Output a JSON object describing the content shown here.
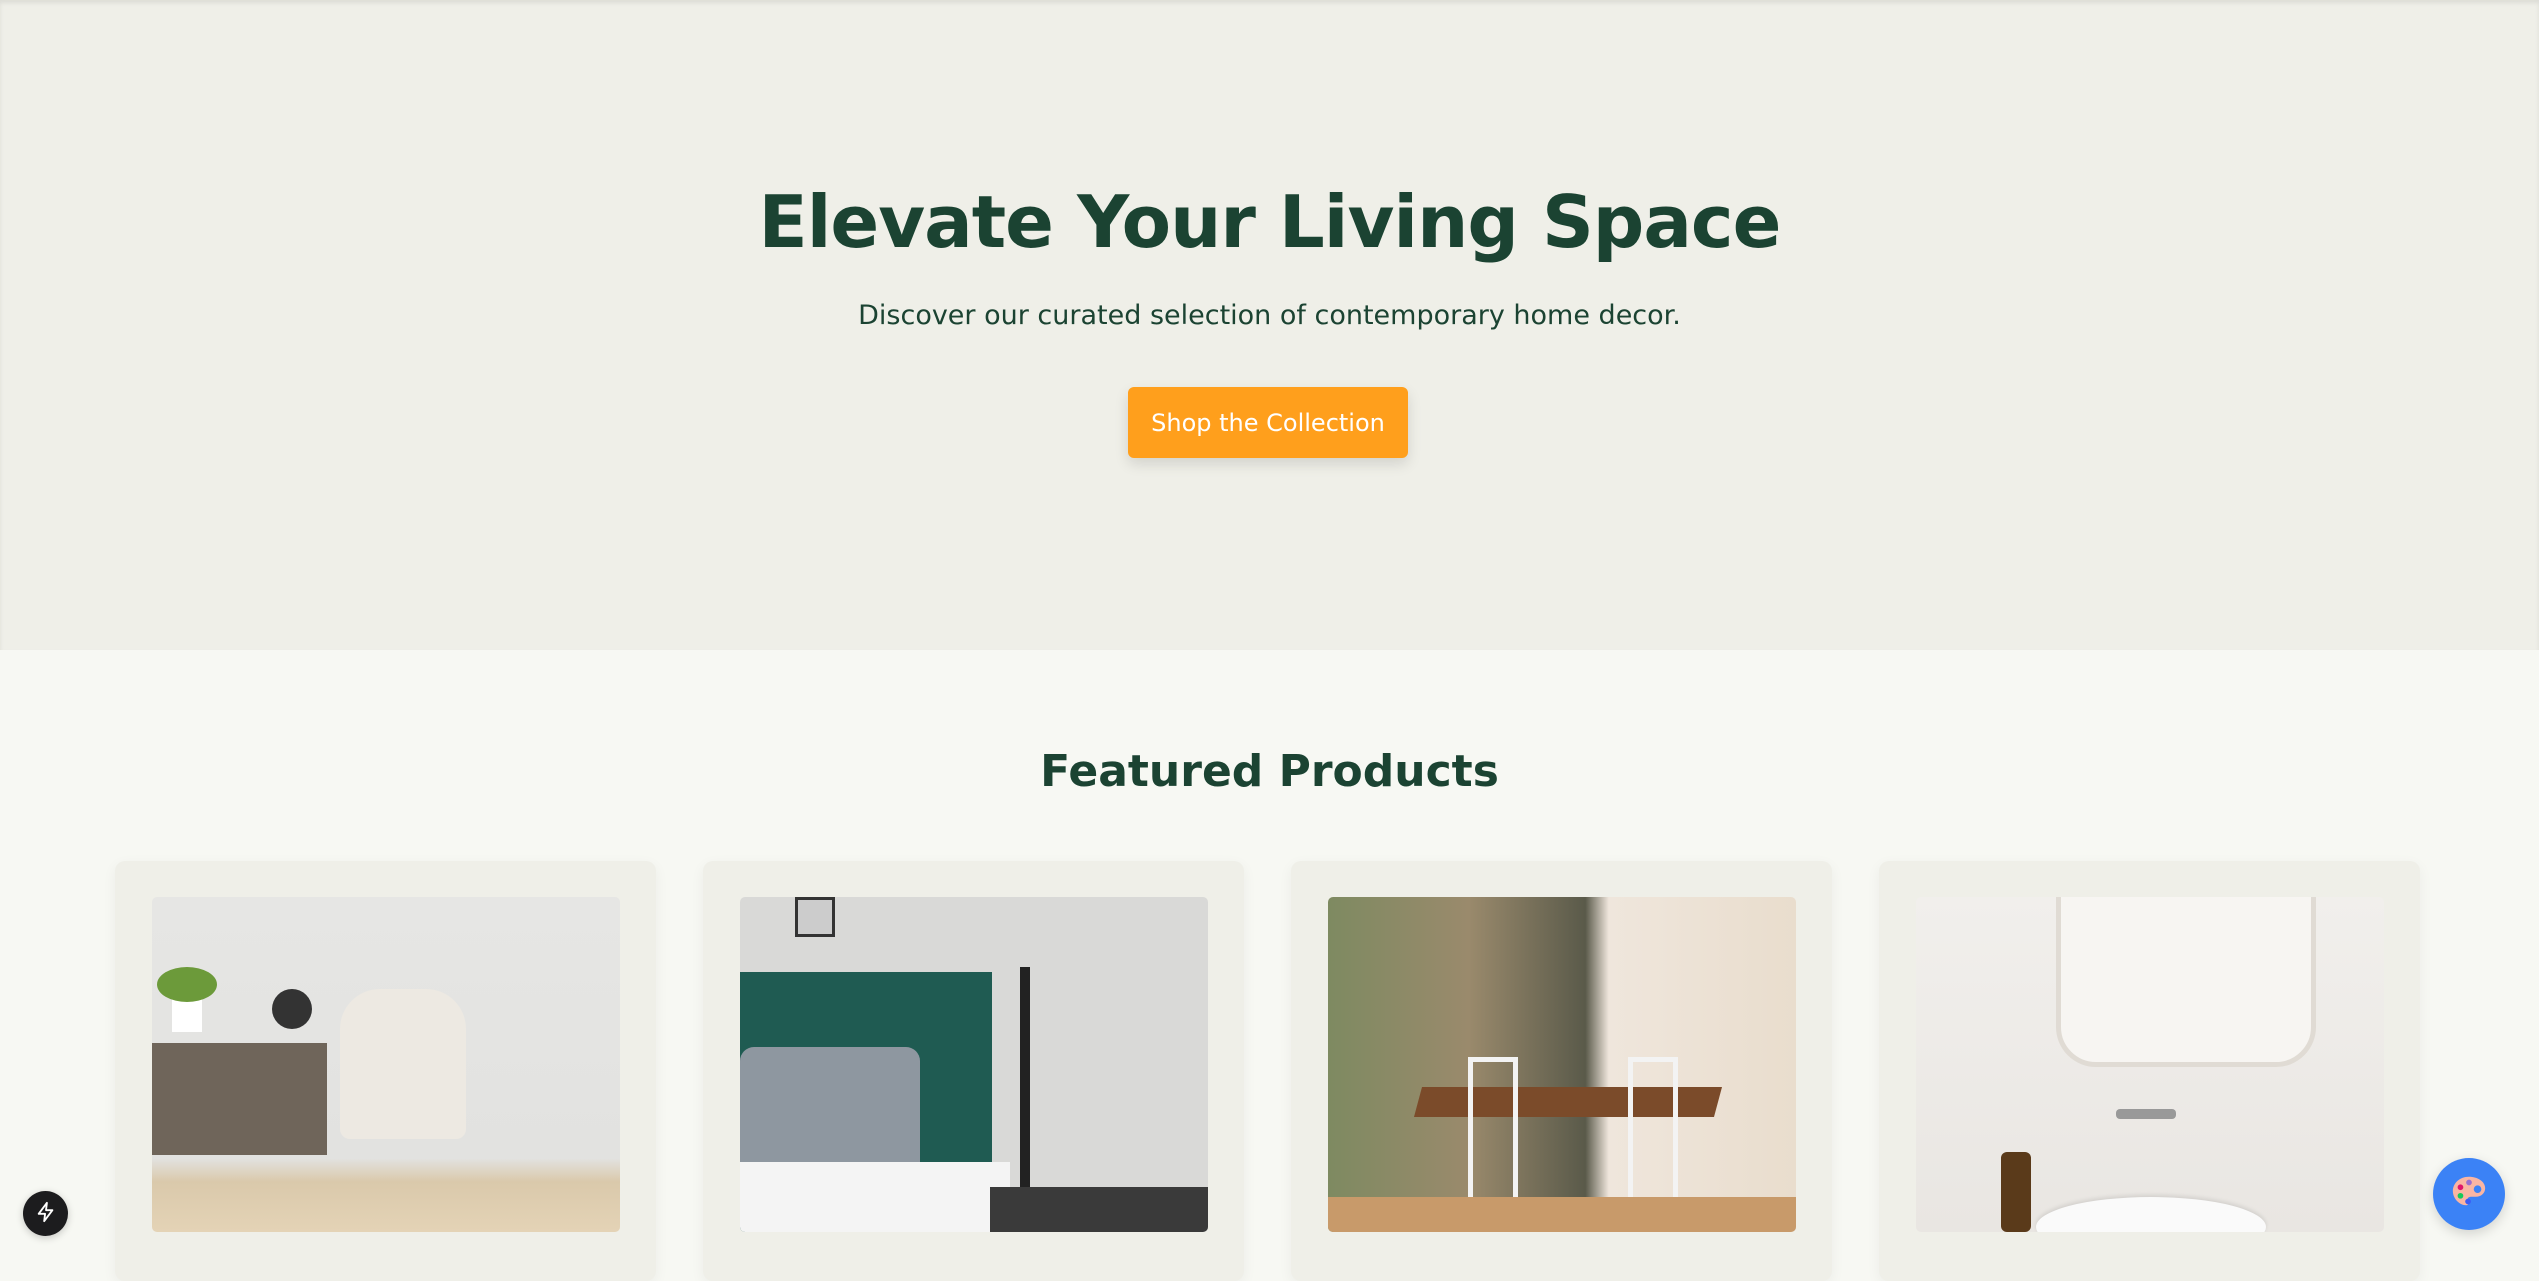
{
  "hero": {
    "title": "Elevate Your Living Space",
    "subtitle": "Discover our curated selection of contemporary home decor.",
    "cta_label": "Shop the Collection"
  },
  "featured": {
    "title": "Featured Products",
    "products": [
      {
        "image": "armchair-and-sideboard"
      },
      {
        "image": "bedroom-with-lamp"
      },
      {
        "image": "dining-table-forest-view"
      },
      {
        "image": "bathroom-sink-mirror"
      }
    ]
  },
  "colors": {
    "brand": "#1b4332",
    "accent": "#ff9f1c",
    "palette_button": "#3b82f6"
  },
  "icons": {
    "bottom_left": "lightning-icon",
    "bottom_right": "palette-icon"
  }
}
